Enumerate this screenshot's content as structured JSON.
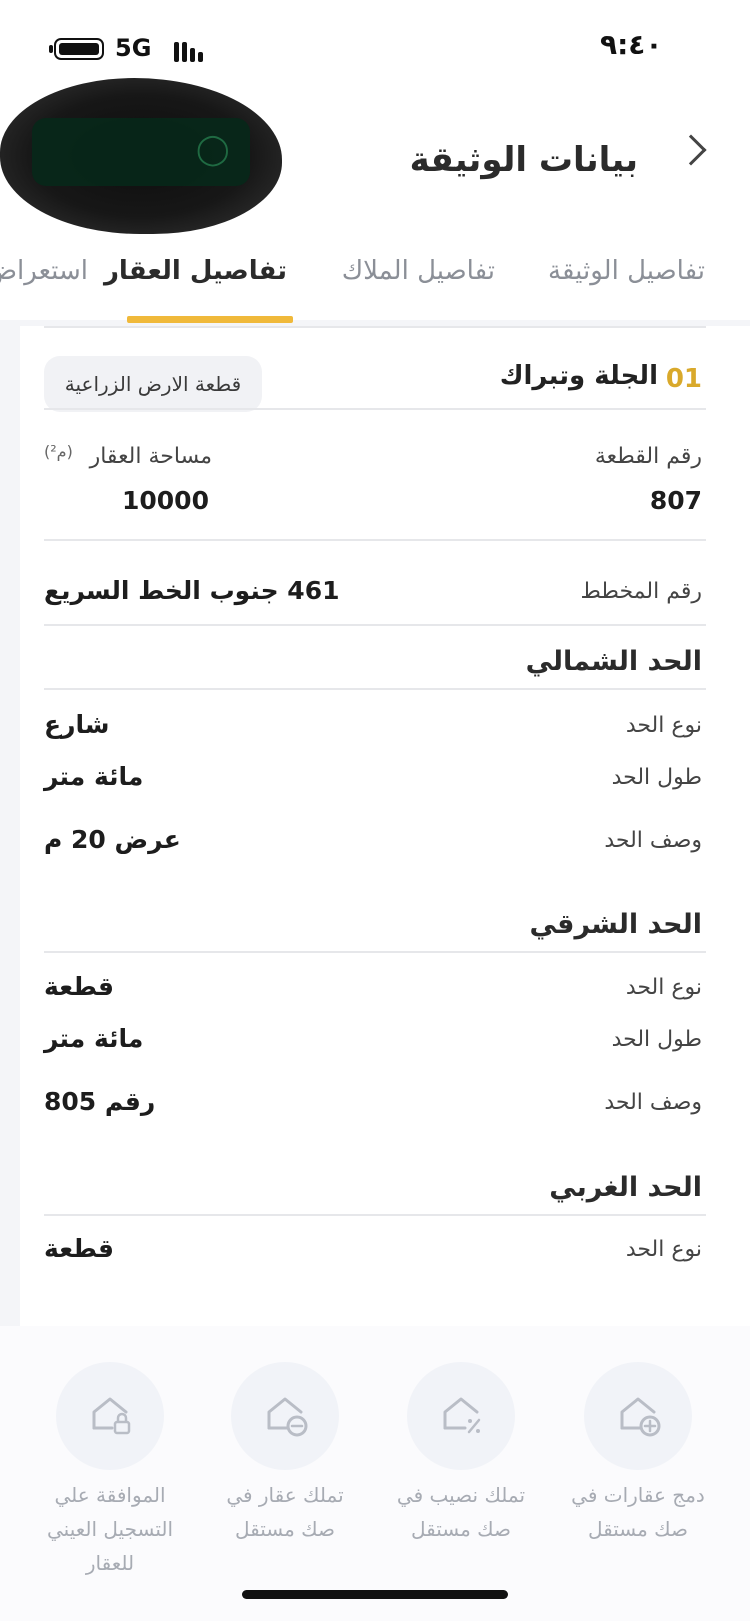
{
  "status_bar": {
    "network": "5G",
    "time": "٩:٤٠"
  },
  "header": {
    "title": "بيانات الوثيقة"
  },
  "tabs": [
    {
      "label": "تفاصيل الوثيقة"
    },
    {
      "label": "تفاصيل الملاك"
    },
    {
      "label": "تفاصيل العقار"
    },
    {
      "label": "استعراض"
    }
  ],
  "property": {
    "index": "01",
    "name": "الجلة وتبراك",
    "type_chip": "قطعة الارض الزراعية",
    "plot_number_label": "رقم القطعة",
    "plot_number_value": "807",
    "area_label": "مساحة العقار",
    "area_unit": "(م²)",
    "area_value": "10000",
    "plan_number_label": "رقم المخطط",
    "plan_number_value": "461 جنوب الخط السريع"
  },
  "boundaries": [
    {
      "title": "الحد الشمالي",
      "type_label": "نوع الحد",
      "type_value": "شارع",
      "length_label": "طول الحد",
      "length_value": "مائة متر",
      "desc_label": "وصف الحد",
      "desc_value": "عرض 20 م"
    },
    {
      "title": "الحد الشرقي",
      "type_label": "نوع الحد",
      "type_value": "قطعة",
      "length_label": "طول الحد",
      "length_value": "مائة متر",
      "desc_label": "وصف الحد",
      "desc_value": "رقم 805"
    },
    {
      "title": "الحد الغربي",
      "type_label": "نوع الحد",
      "type_value": "قطعة"
    }
  ],
  "actions": [
    {
      "label_line1": "دمج عقارات في",
      "label_line2": "صك مستقل",
      "icon": "home-plus-icon"
    },
    {
      "label_line1": "تملك نصيب في",
      "label_line2": "صك مستقل",
      "icon": "home-percent-icon"
    },
    {
      "label_line1": "تملك عقار في",
      "label_line2": "صك مستقل",
      "icon": "home-minus-icon"
    },
    {
      "label_line1": "الموافقة علي",
      "label_line2": "التسجيل العيني",
      "label_line3": "للعقار",
      "icon": "home-lock-icon"
    }
  ],
  "colors": {
    "accent": "#f0b93a",
    "index_color": "#d9a92b"
  }
}
